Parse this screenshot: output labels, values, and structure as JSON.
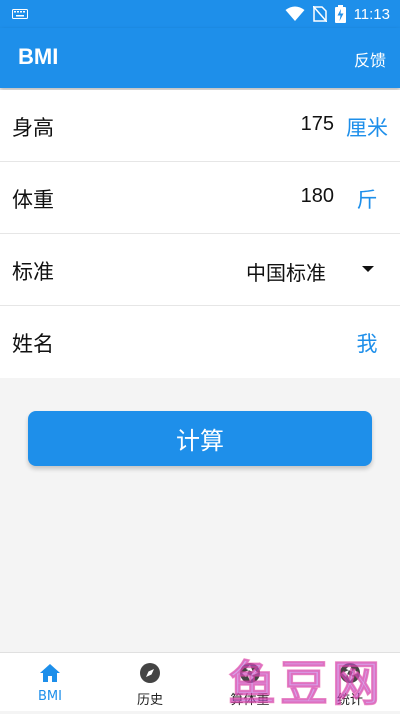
{
  "status_bar": {
    "time": "11:13",
    "icons": [
      "keyboard-icon",
      "wifi-icon",
      "no-sim-icon",
      "battery-charging-icon"
    ]
  },
  "app_bar": {
    "title": "BMI",
    "action": "反馈"
  },
  "form": {
    "height": {
      "label": "身高",
      "value": "175",
      "unit": "厘米"
    },
    "weight": {
      "label": "体重",
      "value": "180",
      "unit": "斤"
    },
    "standard": {
      "label": "标准",
      "value": "中国标准"
    },
    "name": {
      "label": "姓名",
      "value": "我"
    }
  },
  "calculate_button": "计算",
  "bottom_nav": [
    {
      "label": "BMI",
      "icon": "home-icon",
      "active": true
    },
    {
      "label": "历史",
      "icon": "compass-icon",
      "active": false
    },
    {
      "label": "算体重",
      "icon": "aperture-icon",
      "active": false
    },
    {
      "label": "统计",
      "icon": "aperture-icon",
      "active": false
    }
  ],
  "watermark": "鱼豆网",
  "colors": {
    "accent": "#1e8fea",
    "background": "#f4f4f4"
  }
}
